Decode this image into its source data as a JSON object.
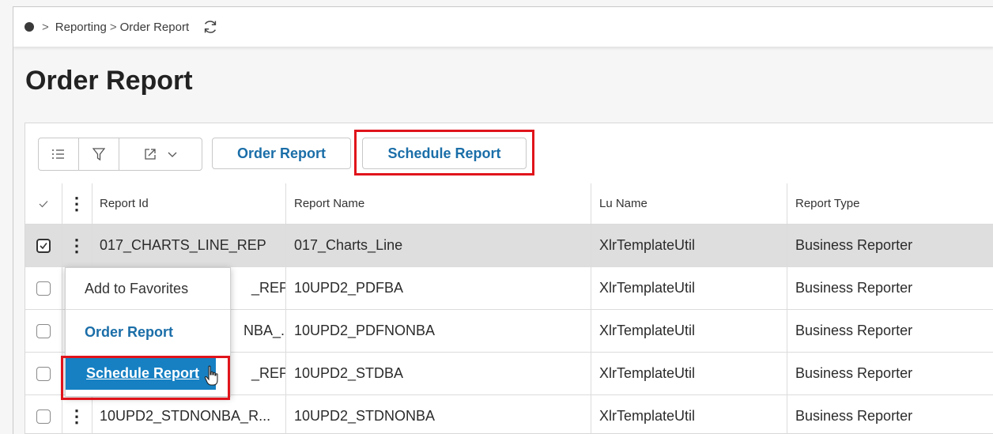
{
  "breadcrumb": {
    "items": [
      "Reporting",
      "Order Report"
    ],
    "separator": ">"
  },
  "page_title": "Order Report",
  "toolbar": {
    "order_report_label": "Order Report",
    "schedule_report_label": "Schedule Report"
  },
  "table": {
    "columns": [
      "Report Id",
      "Report Name",
      "Lu Name",
      "Report Type"
    ],
    "rows": [
      {
        "id": "017_CHARTS_LINE_REP",
        "name": "017_Charts_Line",
        "lu": "XlrTemplateUtil",
        "type": "Business Reporter",
        "selected": true
      },
      {
        "id": "_REP",
        "name": "10UPD2_PDFBA",
        "lu": "XlrTemplateUtil",
        "type": "Business Reporter",
        "selected": false
      },
      {
        "id": "NBA_...",
        "name": "10UPD2_PDFNONBA",
        "lu": "XlrTemplateUtil",
        "type": "Business Reporter",
        "selected": false
      },
      {
        "id": "_REP",
        "name": "10UPD2_STDBA",
        "lu": "XlrTemplateUtil",
        "type": "Business Reporter",
        "selected": false
      },
      {
        "id": "10UPD2_STDNONBA_R...",
        "name": "10UPD2_STDNONBA",
        "lu": "XlrTemplateUtil",
        "type": "Business Reporter",
        "selected": false
      }
    ]
  },
  "context_menu": {
    "items": [
      "Add to Favorites",
      "Order Report",
      "Schedule Report"
    ]
  },
  "colors": {
    "accent": "#1a6ea8",
    "menu_highlight": "#1680c3",
    "annotation": "#e0141b",
    "selected_row": "#dedede"
  }
}
